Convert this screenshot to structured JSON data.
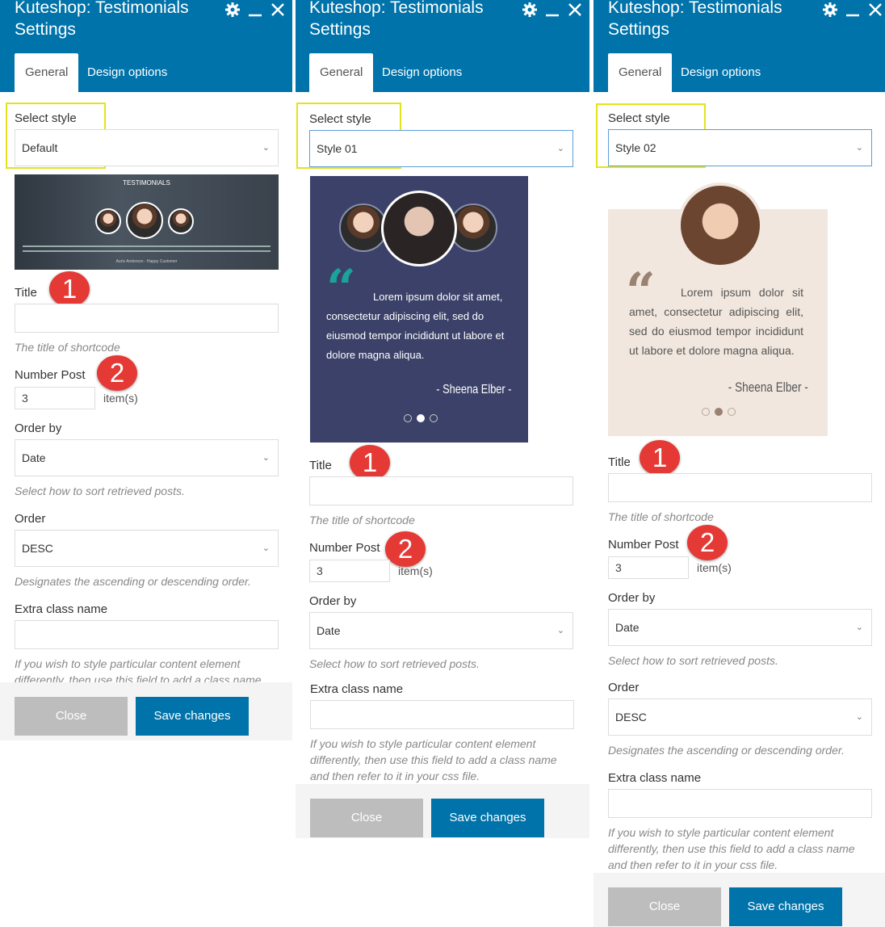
{
  "app_title": "Kuteshop: Testimonials Settings",
  "tabs": [
    "General",
    "Design options"
  ],
  "labels": {
    "select_style": "Select style",
    "title": "Title",
    "number_post": "Number Post",
    "order_by": "Order by",
    "order": "Order",
    "extra_class": "Extra class name",
    "items_unit": "item(s)"
  },
  "help": {
    "title": "The title of shortcode",
    "order_by": "Select how to sort retrieved posts.",
    "order": "Designates the ascending or descending order.",
    "extra_class": "If you wish to style particular content element differently, then use this field to add a class name and then refer to it in your css file.",
    "extra_class_cut": "If you wish to style particular content element differently, then use this field to add a class name"
  },
  "buttons": {
    "close": "Close",
    "save": "Save changes"
  },
  "panels": [
    {
      "style": "Default",
      "number_post": "3",
      "order_by": "Date",
      "order": "DESC"
    },
    {
      "style": "Style 01",
      "number_post": "3",
      "order_by": "Date"
    },
    {
      "style": "Style 02",
      "number_post": "3",
      "order_by": "Date",
      "order": "DESC"
    }
  ],
  "badges": {
    "one": "1",
    "two": "2"
  },
  "preview_default": {
    "heading": "TESTIMONIALS",
    "author": "Auris Anderson - Happy Customer"
  },
  "preview_text": "Lorem ipsum dolor sit amet, consectetur adipiscing elit, sed do eiusmod tempor incididunt ut labore et dolore magna aliqua.",
  "preview_author": "- Sheena Elber -",
  "colors": {
    "header": "#0073aa",
    "highlight": "#e3e31c",
    "badge": "#e53935",
    "style01_bg": "#3b4168",
    "style02_bg": "#f1e7de"
  }
}
